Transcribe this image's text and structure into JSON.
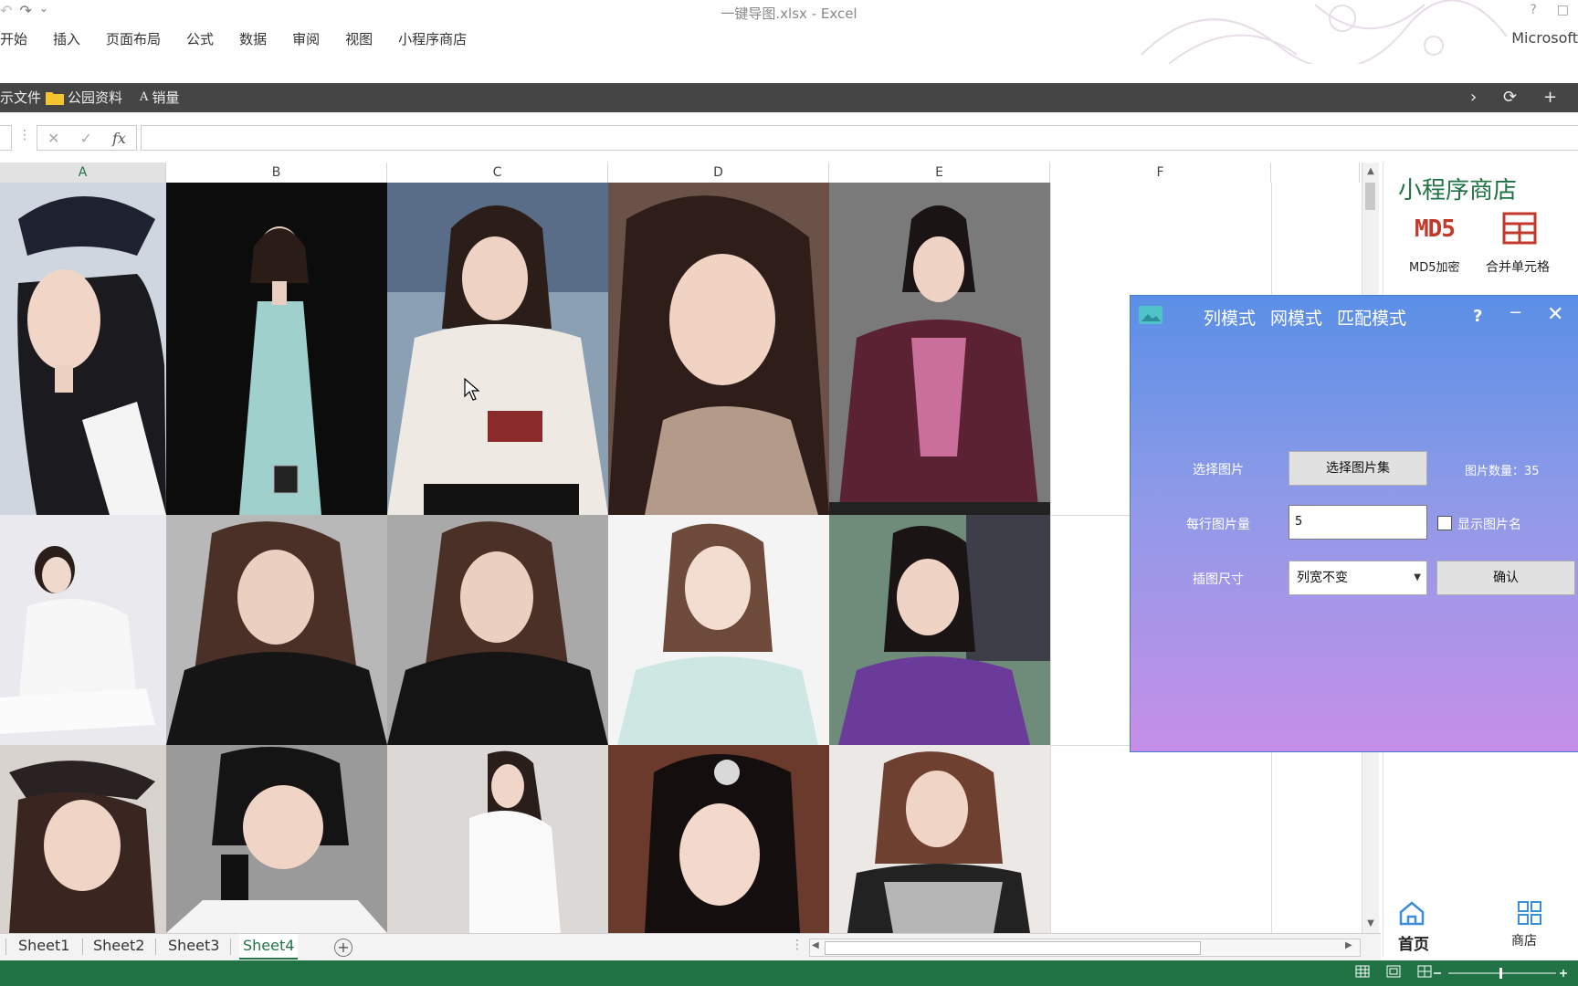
{
  "window": {
    "title": "一键导图.xlsx - Excel",
    "account": "Microsoft",
    "help_glyph": "?",
    "restore_glyph": "□"
  },
  "quick_access": {
    "undo": "↶",
    "redo": "↷",
    "more": "⌄"
  },
  "ribbon": {
    "tabs": [
      "开始",
      "插入",
      "页面布局",
      "公式",
      "数据",
      "审阅",
      "视图",
      "小程序商店"
    ]
  },
  "toolbar": {
    "item1": "示文件",
    "item2": "公园资料",
    "item3_prefix": "A",
    "item3": "销量",
    "next": "›",
    "refresh": "⟳",
    "add": "+"
  },
  "formula_bar": {
    "cancel": "✕",
    "enter": "✓",
    "fx": "fx",
    "value": "",
    "more": "⋮"
  },
  "columns": [
    "A",
    "B",
    "C",
    "D",
    "E",
    "F"
  ],
  "selected_column": "A",
  "images": {
    "row1": [
      "photo-woman-black-hat-dress",
      "photo-woman-teal-gown",
      "photo-woman-lace-blouse-mic",
      "photo-woman-smiling-closeup",
      "photo-woman-costume-drama"
    ],
    "row2": [
      "photo-woman-white-sweater",
      "photo-woman-black-bow-blouse",
      "photo-woman-black-bow-foil",
      "photo-woman-mint-dress",
      "photo-woman-purple-costume"
    ],
    "row3": [
      "photo-woman-hat-smile",
      "photo-woman-bangs-gloves",
      "photo-woman-white-top-profile",
      "photo-woman-hair-ornament",
      "photo-woman-striped-top"
    ]
  },
  "side_panel": {
    "title": "小程序商店",
    "md5_icon_text": "MD5",
    "md5_label": "MD5加密",
    "merge_label": "合并单元格",
    "home_label": "首页",
    "shop_label": "商店"
  },
  "dialog": {
    "tabs": [
      "列模式",
      "网模式",
      "匹配模式"
    ],
    "help": "?",
    "minimize": "−",
    "close": "✕",
    "select_image_label": "选择图片",
    "select_image_button": "选择图片集",
    "image_count": "图片数量：35",
    "per_row_label": "每行图片量",
    "per_row_value": "5",
    "show_name_label": "显示图片名",
    "show_name_checked": false,
    "size_label": "插图尺寸",
    "size_value": "列宽不变",
    "confirm_button": "确认"
  },
  "sheets": {
    "tabs": [
      "Sheet1",
      "Sheet2",
      "Sheet3",
      "Sheet4"
    ],
    "active": "Sheet4",
    "add": "+"
  },
  "colors": {
    "excel_green": "#217346",
    "dialog_top": "#5a8fe6",
    "dialog_bottom": "#c58fe8",
    "toolbar_dark": "#454545",
    "md5_red": "#c0392b"
  }
}
